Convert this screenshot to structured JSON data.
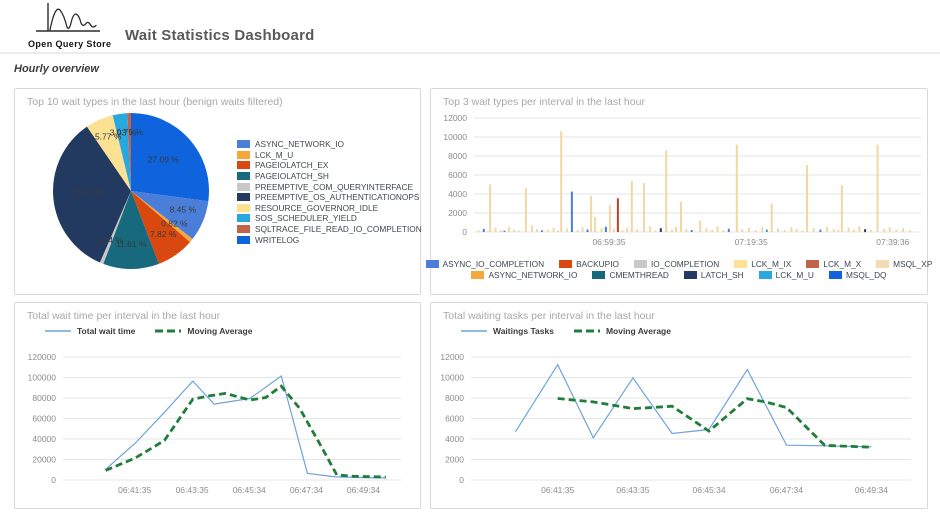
{
  "header": {
    "logo_text": "Open Query Store",
    "title": "Wait Statistics Dashboard"
  },
  "section_title": "Hourly overview",
  "colors": {
    "blue_medium": "#4a7ed9",
    "orange": "#f5a73b",
    "red": "#d9480f",
    "teal": "#17697e",
    "gray": "#c8c8c8",
    "navy": "#233a60",
    "pale_yellow": "#fbe192",
    "cyan": "#29a8e0",
    "salmon": "#c26249",
    "bright_blue": "#0f63dd",
    "tan": "#f2d7a3",
    "pale_tan": "#f2dcb4",
    "bar_red": "#c0432b",
    "line_blue": "#6fa3dc",
    "line_green": "#1e7e3a",
    "grid": "#e6e6e6",
    "tick": "#8c8c8c"
  },
  "chart_data": [
    {
      "type": "pie",
      "title": "Top 10 wait types in the last hour (benign waits filtered)",
      "legend_position": "right",
      "slices": [
        {
          "name": "WRITELOG",
          "value": 27.09,
          "pct_label": "27.09 %",
          "color": "#0f63dd"
        },
        {
          "name": "ASYNC_NETWORK_IO",
          "value": 8.45,
          "pct_label": "8.45 %",
          "color": "#4a7ed9"
        },
        {
          "name": "LCK_M_U",
          "value": 0.82,
          "pct_label": "0.82 %",
          "color": "#f5a73b"
        },
        {
          "name": "PAGEIOLATCH_EX",
          "value": 7.82,
          "pct_label": "7.82 %",
          "color": "#d9480f"
        },
        {
          "name": "PAGEIOLATCH_SH",
          "value": 11.61,
          "pct_label": "11.61 %",
          "color": "#17697e"
        },
        {
          "name": "PREEMPTIVE_COM_QUERYINTERFACE",
          "value": 0.74,
          "pct_label": "0.74 %",
          "color": "#c8c8c8"
        },
        {
          "name": "PREEMPTIVE_OS_AUTHENTICATIONOPS",
          "value": 33.92,
          "pct_label": "33.92 %",
          "color": "#233a60"
        },
        {
          "name": "RESOURCE_GOVERNOR_IDLE",
          "value": 5.77,
          "pct_label": "5.77 %",
          "color": "#fbe192"
        },
        {
          "name": "SOS_SCHEDULER_YIELD",
          "value": 3.03,
          "pct_label": "3.03 %",
          "color": "#29a8e0"
        },
        {
          "name": "SQLTRACE_FILE_READ_IO_COMPLETION",
          "value": 0.75,
          "pct_label": "0.75 %",
          "color": "#c26249"
        }
      ]
    },
    {
      "type": "bar",
      "title": "Top 3 wait types per interval in the last hour",
      "ylim": [
        0,
        12000
      ],
      "ytick_step": 2000,
      "grid": true,
      "x_ticks": [
        {
          "label": "06:59:35",
          "x": 0.302
        },
        {
          "label": "07:19:35",
          "x": 0.62
        },
        {
          "label": "07:39:36",
          "x": 0.937
        }
      ],
      "legend_rows": [
        [
          {
            "label": "ASYNC_IO_COMPLETION",
            "color": "#4a7ed9"
          },
          {
            "label": "BACKUPIO",
            "color": "#d9480f"
          },
          {
            "label": "IO_COMPLETION",
            "color": "#c8c8c8"
          },
          {
            "label": "LCK_M_IX",
            "color": "#fbe192"
          },
          {
            "label": "LCK_M_X",
            "color": "#c26249"
          },
          {
            "label": "MSQL_XP",
            "color": "#f2dcb4"
          }
        ],
        [
          {
            "label": "ASYNC_NETWORK_IO",
            "color": "#f5a73b"
          },
          {
            "label": "CMEMTHREAD",
            "color": "#17697e"
          },
          {
            "label": "LATCH_SH",
            "color": "#233a60"
          },
          {
            "label": "LCK_M_U",
            "color": "#29a8e0"
          },
          {
            "label": "MSQL_DQ",
            "color": "#0f63dd"
          }
        ]
      ],
      "bar_color_keys": {
        "t": "tan",
        "b": "blue_medium",
        "r": "bar_red",
        "n": "navy",
        "c": "cyan",
        "g": "gray"
      },
      "bars": [
        [
          0.01,
          180,
          "t"
        ],
        [
          0.022,
          320,
          "b"
        ],
        [
          0.032,
          140,
          "t"
        ],
        [
          0.036,
          5000,
          "t"
        ],
        [
          0.048,
          450,
          "t"
        ],
        [
          0.06,
          200,
          "t"
        ],
        [
          0.068,
          140,
          "b"
        ],
        [
          0.078,
          520,
          "t"
        ],
        [
          0.09,
          260,
          "t"
        ],
        [
          0.1,
          150,
          "t"
        ],
        [
          0.116,
          4600,
          "t"
        ],
        [
          0.13,
          700,
          "t"
        ],
        [
          0.141,
          300,
          "t"
        ],
        [
          0.152,
          180,
          "b"
        ],
        [
          0.165,
          240,
          "t"
        ],
        [
          0.178,
          420,
          "t"
        ],
        [
          0.188,
          160,
          "t"
        ],
        [
          0.195,
          10600,
          "t"
        ],
        [
          0.208,
          350,
          "t"
        ],
        [
          0.219,
          4250,
          "b"
        ],
        [
          0.232,
          220,
          "t"
        ],
        [
          0.243,
          500,
          "t"
        ],
        [
          0.254,
          260,
          "b"
        ],
        [
          0.262,
          3800,
          "t"
        ],
        [
          0.271,
          1600,
          "t"
        ],
        [
          0.285,
          380,
          "t"
        ],
        [
          0.295,
          550,
          "b"
        ],
        [
          0.304,
          2800,
          "t"
        ],
        [
          0.313,
          300,
          "t"
        ],
        [
          0.322,
          3550,
          "r"
        ],
        [
          0.332,
          200,
          "t"
        ],
        [
          0.342,
          450,
          "t"
        ],
        [
          0.353,
          5400,
          "t"
        ],
        [
          0.365,
          280,
          "t"
        ],
        [
          0.38,
          5150,
          "t"
        ],
        [
          0.394,
          600,
          "t"
        ],
        [
          0.406,
          180,
          "t"
        ],
        [
          0.418,
          400,
          "n"
        ],
        [
          0.43,
          8600,
          "t"
        ],
        [
          0.443,
          250,
          "t"
        ],
        [
          0.452,
          520,
          "t"
        ],
        [
          0.463,
          3200,
          "t"
        ],
        [
          0.475,
          300,
          "t"
        ],
        [
          0.487,
          200,
          "b"
        ],
        [
          0.506,
          1200,
          "t"
        ],
        [
          0.52,
          400,
          "t"
        ],
        [
          0.533,
          250,
          "t"
        ],
        [
          0.545,
          600,
          "t"
        ],
        [
          0.558,
          180,
          "t"
        ],
        [
          0.57,
          350,
          "b"
        ],
        [
          0.588,
          9200,
          "t"
        ],
        [
          0.6,
          300,
          "t"
        ],
        [
          0.615,
          450,
          "t"
        ],
        [
          0.63,
          200,
          "t"
        ],
        [
          0.645,
          550,
          "t"
        ],
        [
          0.655,
          250,
          "c"
        ],
        [
          0.666,
          3000,
          "t"
        ],
        [
          0.68,
          350,
          "t"
        ],
        [
          0.695,
          200,
          "t"
        ],
        [
          0.71,
          500,
          "t"
        ],
        [
          0.722,
          300,
          "t"
        ],
        [
          0.735,
          150,
          "t"
        ],
        [
          0.745,
          7050,
          "t"
        ],
        [
          0.76,
          400,
          "t"
        ],
        [
          0.775,
          250,
          "b"
        ],
        [
          0.79,
          550,
          "t"
        ],
        [
          0.805,
          300,
          "t"
        ],
        [
          0.815,
          200,
          "t"
        ],
        [
          0.823,
          4950,
          "t"
        ],
        [
          0.838,
          450,
          "t"
        ],
        [
          0.85,
          250,
          "t"
        ],
        [
          0.862,
          600,
          "t"
        ],
        [
          0.875,
          300,
          "n"
        ],
        [
          0.888,
          200,
          "t"
        ],
        [
          0.903,
          9200,
          "t"
        ],
        [
          0.918,
          350,
          "t"
        ],
        [
          0.93,
          500,
          "t"
        ],
        [
          0.945,
          250,
          "t"
        ],
        [
          0.96,
          400,
          "t"
        ],
        [
          0.975,
          180,
          "t"
        ]
      ]
    },
    {
      "type": "line",
      "title": "Total wait time per interval in the last hour",
      "ylim": [
        0,
        120000
      ],
      "ytick_step": 20000,
      "grid": true,
      "legend_position": "top-left",
      "x_ticks": [
        {
          "label": "06:41:35",
          "x": 0.212
        },
        {
          "label": "06:43:35",
          "x": 0.382
        },
        {
          "label": "06:45:34",
          "x": 0.551
        },
        {
          "label": "06:47:34",
          "x": 0.72
        },
        {
          "label": "06:49:34",
          "x": 0.889
        }
      ],
      "series": [
        {
          "name": "Total wait time",
          "style": "solid",
          "color_key": "line_blue",
          "points": [
            [
              0.126,
              10400
            ],
            [
              0.214,
              36000
            ],
            [
              0.3,
              66000
            ],
            [
              0.384,
              96500
            ],
            [
              0.447,
              74000
            ],
            [
              0.553,
              79500
            ],
            [
              0.646,
              101500
            ],
            [
              0.723,
              6500
            ],
            [
              0.806,
              3000
            ],
            [
              0.893,
              2300
            ],
            [
              0.955,
              2000
            ]
          ]
        },
        {
          "name": "Moving Average",
          "style": "dashed",
          "color_key": "line_green",
          "points": [
            [
              0.126,
              9400
            ],
            [
              0.214,
              21500
            ],
            [
              0.3,
              38500
            ],
            [
              0.384,
              78800
            ],
            [
              0.43,
              82000
            ],
            [
              0.48,
              84500
            ],
            [
              0.553,
              78000
            ],
            [
              0.6,
              80500
            ],
            [
              0.646,
              91500
            ],
            [
              0.7,
              70000
            ],
            [
              0.76,
              35000
            ],
            [
              0.81,
              5000
            ],
            [
              0.86,
              3600
            ],
            [
              0.91,
              3200
            ],
            [
              0.955,
              2900
            ]
          ]
        }
      ]
    },
    {
      "type": "line",
      "title": "Total waiting tasks per interval in the last hour",
      "ylim": [
        0,
        12000
      ],
      "ytick_step": 2000,
      "grid": true,
      "legend_position": "top-left",
      "x_ticks": [
        {
          "label": "06:41:35",
          "x": 0.197
        },
        {
          "label": "06:43:35",
          "x": 0.368
        },
        {
          "label": "06:45:34",
          "x": 0.541
        },
        {
          "label": "06:47:34",
          "x": 0.717
        },
        {
          "label": "06:49:34",
          "x": 0.91
        }
      ],
      "series": [
        {
          "name": "Waitings Tasks",
          "style": "solid",
          "color_key": "line_blue",
          "points": [
            [
              0.101,
              4700
            ],
            [
              0.197,
              11250
            ],
            [
              0.278,
              4120
            ],
            [
              0.368,
              9960
            ],
            [
              0.457,
              4540
            ],
            [
              0.541,
              4930
            ],
            [
              0.628,
              10770
            ],
            [
              0.717,
              3400
            ],
            [
              0.804,
              3340
            ],
            [
              0.91,
              3240
            ]
          ]
        },
        {
          "name": "Moving Average",
          "style": "dashed",
          "color_key": "line_green",
          "points": [
            [
              0.197,
              7950
            ],
            [
              0.278,
              7620
            ],
            [
              0.323,
              7300
            ],
            [
              0.368,
              6970
            ],
            [
              0.413,
              7070
            ],
            [
              0.457,
              7200
            ],
            [
              0.541,
              4770
            ],
            [
              0.628,
              7930
            ],
            [
              0.669,
              7620
            ],
            [
              0.717,
              7070
            ],
            [
              0.804,
              3380
            ],
            [
              0.91,
              3200
            ]
          ]
        }
      ]
    }
  ]
}
